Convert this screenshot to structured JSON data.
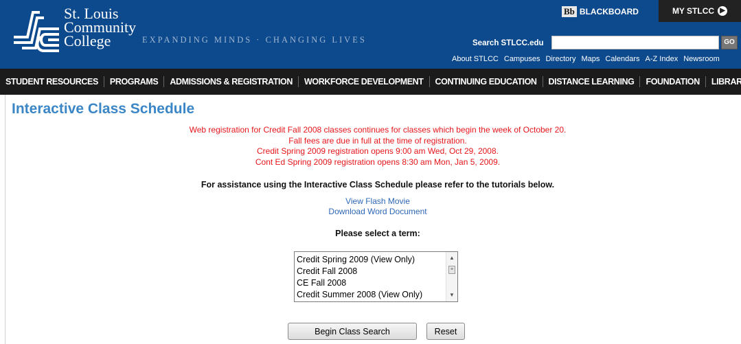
{
  "header": {
    "logo": {
      "line1": "St. Louis",
      "line2": "Community",
      "line3": "College"
    },
    "tagline": "EXPANDING MINDS · CHANGING LIVES",
    "blackboard": {
      "badge": "Bb",
      "label": "BLACKBOARD"
    },
    "mystlcc": "MY STLCC",
    "search": {
      "label": "Search STLCC.edu",
      "value": "",
      "button": "GO"
    },
    "util_links": [
      "About STLCC",
      "Campuses",
      "Directory",
      "Maps",
      "Calendars",
      "A-Z Index",
      "Newsroom"
    ]
  },
  "nav": {
    "items": [
      "STUDENT RESOURCES",
      "PROGRAMS",
      "ADMISSIONS & REGISTRATION",
      "WORKFORCE DEVELOPMENT",
      "CONTINUING EDUCATION",
      "DISTANCE LEARNING",
      "FOUNDATION",
      "LIBRARIES"
    ]
  },
  "main": {
    "title": "Interactive Class Schedule",
    "notices": [
      "Web registration for Credit Fall 2008 classes continues for classes which begin the week of October 20.",
      "Fall fees are due in full at the time of registration.",
      "Credit Spring 2009 registration opens 9:00 am Wed, Oct 29, 2008.",
      "Cont Ed Spring 2009 registration opens 8:30 am Mon, Jan 5, 2009."
    ],
    "assistance": "For assistance using the Interactive Class Schedule please refer to the tutorials below.",
    "tutorials": [
      "View Flash Movie",
      "Download Word Document"
    ],
    "select_label": "Please select a term:",
    "terms": [
      "Credit Spring 2009 (View Only)",
      "Credit Fall 2008",
      "CE Fall 2008",
      "Credit Summer 2008 (View Only)"
    ],
    "begin_button": "Begin Class Search",
    "reset_button": "Reset"
  },
  "colors": {
    "header_bg": "#0d4a8d",
    "nav_bg": "#1b1b1b",
    "title": "#3a86c6",
    "notice": "#e8151b",
    "link": "#2d67b6"
  },
  "icons": [
    "stlcc-logo-icon",
    "arrow-right-circle-icon",
    "scroll-up-icon",
    "scroll-down-icon"
  ]
}
